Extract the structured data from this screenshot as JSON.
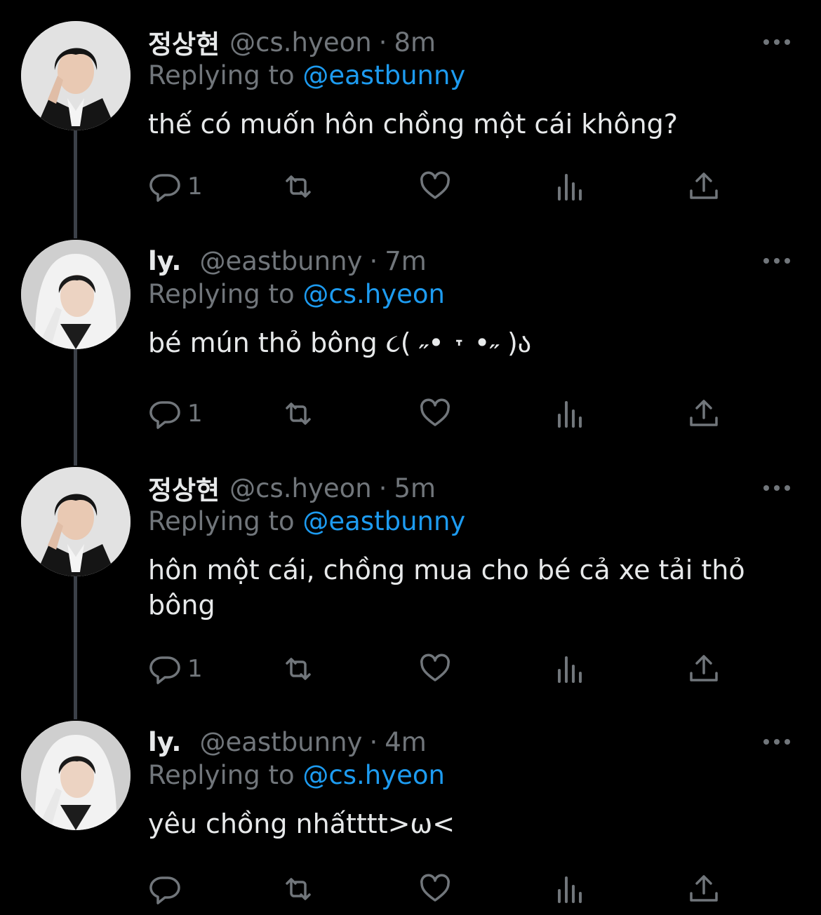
{
  "tweets": [
    {
      "name": "정상현",
      "handle": "@cs.hyeon",
      "time": "8m",
      "replying_prefix": "Replying to",
      "replying_to": "@eastbunny",
      "text": "thế có muốn hôn chồng một cái không?",
      "reply_count": "1",
      "avatar": "avatar-black-suit"
    },
    {
      "name": "ly.",
      "handle": "@eastbunny",
      "time": "7m",
      "replying_prefix": "Replying to",
      "replying_to": "@cs.hyeon",
      "text": "bé mún thỏ bông ૮( ˶• ˕ •˶ )ა",
      "reply_count": "1",
      "avatar": "avatar-white-hood"
    },
    {
      "name": "정상현",
      "handle": "@cs.hyeon",
      "time": "5m",
      "replying_prefix": "Replying to",
      "replying_to": "@eastbunny",
      "text": "hôn một cái, chồng mua cho bé cả xe tải thỏ\nbông",
      "reply_count": "1",
      "avatar": "avatar-black-suit"
    },
    {
      "name": "ly.",
      "handle": "@eastbunny",
      "time": "4m",
      "replying_prefix": "Replying to",
      "replying_to": "@cs.hyeon",
      "text": "yêu chồng nhấtttt>ω<",
      "reply_count": "",
      "avatar": "avatar-white-hood"
    }
  ],
  "separator": "·",
  "icons": {
    "reply": "reply-icon",
    "retweet": "retweet-icon",
    "like": "heart-icon",
    "views": "views-icon",
    "share": "share-icon",
    "more": "more-icon"
  },
  "colors": {
    "background": "#000000",
    "text": "#e7e9ea",
    "muted": "#71767b",
    "link": "#1d9bf0",
    "thread_line": "#3b4048"
  }
}
